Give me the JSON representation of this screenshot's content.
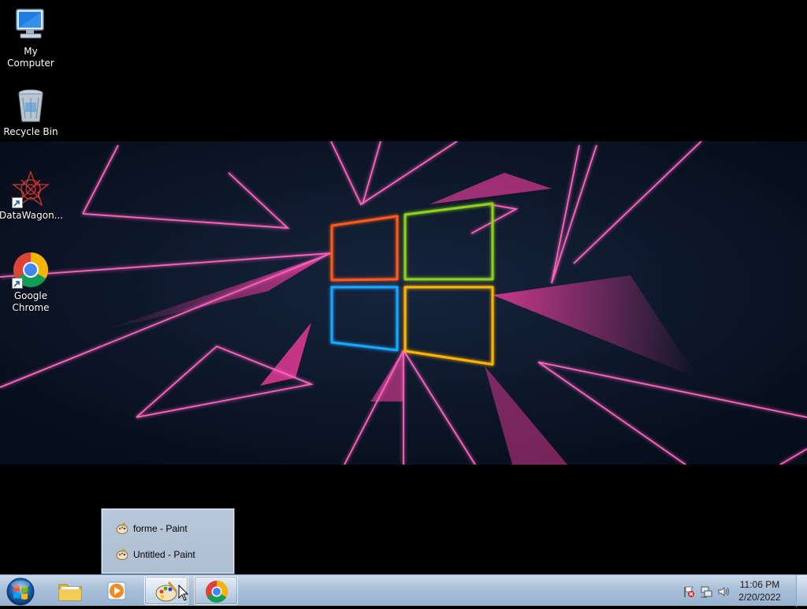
{
  "desktop": {
    "icons": [
      {
        "label": "My Computer",
        "icon": "computer-icon"
      },
      {
        "label": "Recycle Bin",
        "icon": "recycle-bin-icon"
      },
      {
        "label": "DataWagon...",
        "icon": "datawagon-icon",
        "shortcut": true
      },
      {
        "label": "Google Chrome",
        "icon": "chrome-icon",
        "shortcut": true
      }
    ]
  },
  "taskbar": {
    "start_icon": "windows-orb-icon",
    "buttons": [
      {
        "name": "file-explorer",
        "icon": "folder-icon",
        "running": false
      },
      {
        "name": "media-player",
        "icon": "media-player-icon",
        "running": false
      },
      {
        "name": "paint",
        "icon": "paint-palette-icon",
        "running": true,
        "active": true
      },
      {
        "name": "chrome",
        "icon": "chrome-icon",
        "running": true
      }
    ],
    "tray": {
      "icons": [
        "action-center-flag-icon",
        "network-icon",
        "volume-icon"
      ],
      "time": "11:06 PM",
      "date": "2/20/2022"
    }
  },
  "paint_popup": {
    "items": [
      {
        "label": "forme - Paint",
        "icon": "paint-palette-icon"
      },
      {
        "label": "Untitled - Paint",
        "icon": "paint-palette-icon"
      }
    ]
  },
  "colors": {
    "wallpaper_bg": "#0b1526",
    "neon_pink": "#ff4fb0",
    "logo_orange": "#ff5a1f",
    "logo_green": "#8fd21a",
    "logo_blue": "#1aa7ff",
    "logo_yellow": "#ffb400",
    "taskbar": "#a9c0d9"
  }
}
